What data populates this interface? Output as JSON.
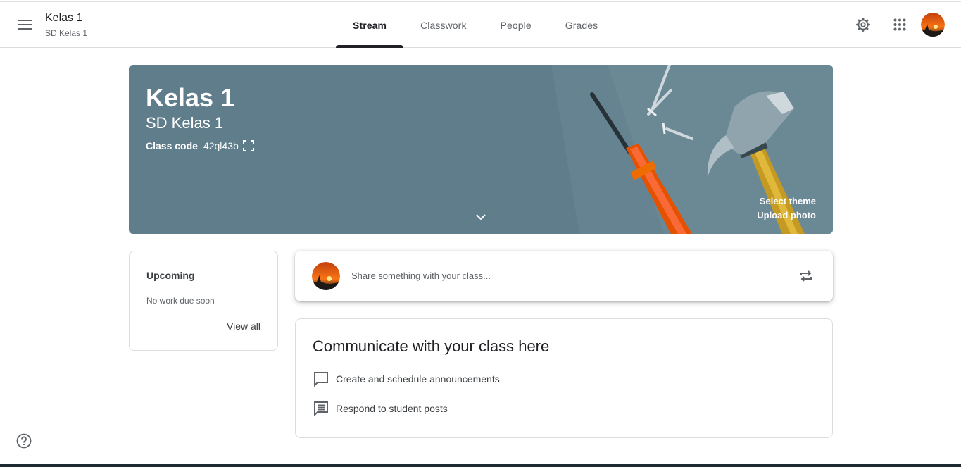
{
  "header": {
    "class_name": "Kelas 1",
    "class_section": "SD Kelas 1",
    "tabs": [
      {
        "label": "Stream",
        "active": true
      },
      {
        "label": "Classwork",
        "active": false
      },
      {
        "label": "People",
        "active": false
      },
      {
        "label": "Grades",
        "active": false
      }
    ],
    "icons": [
      "menu-icon",
      "gear-icon",
      "apps-grid-icon",
      "profile-avatar"
    ]
  },
  "banner": {
    "title": "Kelas 1",
    "subtitle": "SD Kelas 1",
    "class_code_label": "Class code",
    "class_code_value": "42ql43b",
    "select_theme": "Select theme",
    "upload_photo": "Upload photo",
    "background_color": "#607d8b"
  },
  "upcoming": {
    "title": "Upcoming",
    "empty_text": "No work due soon",
    "view_all": "View all"
  },
  "share": {
    "placeholder": "Share something with your class..."
  },
  "communicate": {
    "title": "Communicate with your class here",
    "items": [
      {
        "icon": "chat-bubble-icon",
        "label": "Create and schedule announcements"
      },
      {
        "icon": "message-lines-icon",
        "label": "Respond to student posts"
      }
    ]
  },
  "colors": {
    "accent": "#202124",
    "banner": "#607d8b",
    "text_secondary": "#5f6368"
  }
}
